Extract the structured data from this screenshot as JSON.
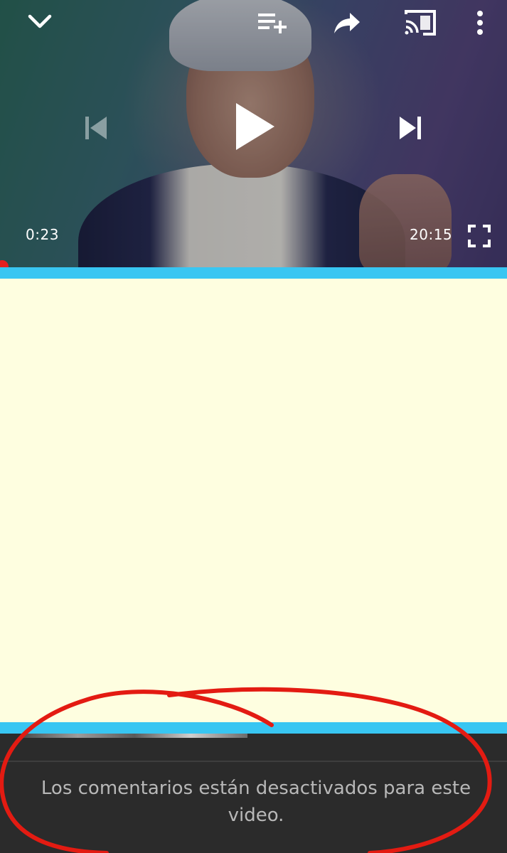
{
  "player": {
    "current_time": "0:23",
    "duration": "20:15",
    "icons": {
      "collapse": "chevron-down-icon",
      "add_to_queue": "playlist-add-icon",
      "share": "share-icon",
      "cast": "cast-icon",
      "more": "more-vert-icon",
      "previous": "skip-previous-icon",
      "play": "play-icon",
      "next": "skip-next-icon",
      "fullscreen": "fullscreen-icon"
    }
  },
  "comments": {
    "disabled_message": "Los comentarios están desactivados para este video."
  },
  "colors": {
    "accent_cyan": "#38c6f2",
    "panel_cream": "#fefee0",
    "progress_red": "#e52020",
    "annotation_red": "#e31b12"
  }
}
